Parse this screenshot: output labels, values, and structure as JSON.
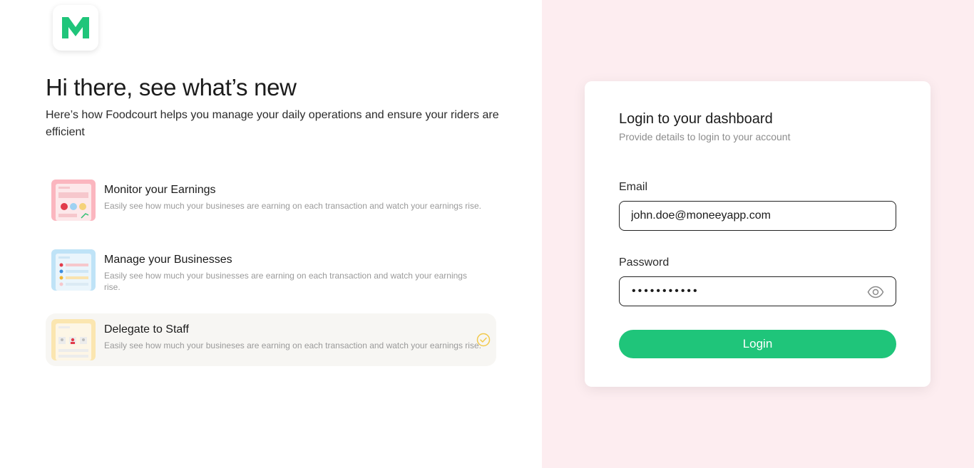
{
  "brand": {
    "logo_letter": "M",
    "accent": "#1fc57a",
    "panel_bg": "#fdedf0"
  },
  "intro": {
    "headline": "Hi there, see what’s new",
    "subhead": "Here’s how Foodcourt helps you manage your daily operations and ensure your riders are efficient"
  },
  "features": [
    {
      "title": "Monitor your Earnings",
      "desc": "Easily see how much your busineses are earning on each transaction and watch your earnings rise.",
      "icon": "earnings-thumbnail",
      "color": "#fbb6bf"
    },
    {
      "title": "Manage your Businesses",
      "desc": "Easily see how much your businesses are earning on each transaction and watch your earnings rise.",
      "icon": "businesses-thumbnail",
      "color": "#bfe3f7"
    },
    {
      "title": "Delegate to Staff",
      "desc": "Easily see how much your busineses are earning on each transaction and watch your earnings rise.",
      "icon": "staff-thumbnail",
      "color": "#fbe6b0",
      "selected": true,
      "selected_icon": "check-circle-icon",
      "selected_color": "#f2c94c"
    }
  ],
  "login": {
    "title": "Login to your dashboard",
    "subtitle": "Provide details to login to your account",
    "email_label": "Email",
    "email_value": "john.doe@moneeyapp.com",
    "password_label": "Password",
    "password_mask": "•••••••••••",
    "password_toggle_icon": "eye-icon",
    "button_label": "Login"
  }
}
